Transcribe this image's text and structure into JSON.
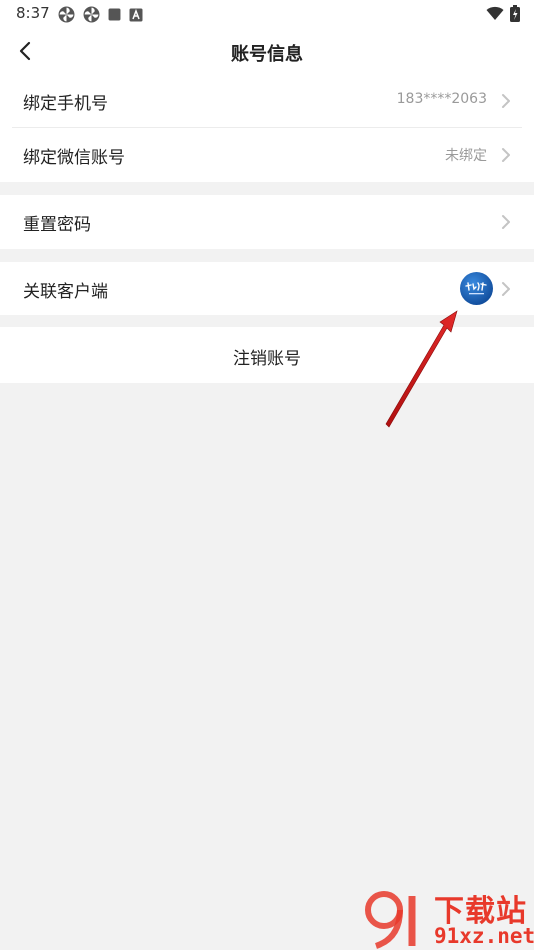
{
  "status_bar": {
    "time": "8:37",
    "icons": [
      "pinwheel-icon",
      "pinwheel-icon",
      "square-icon",
      "a-badge-icon"
    ],
    "right_icons": [
      "wifi-icon",
      "battery-icon"
    ]
  },
  "nav": {
    "title": "账号信息",
    "back_icon": "chevron-left-icon"
  },
  "rows": {
    "phone": {
      "label": "绑定手机号",
      "value": "183****2063"
    },
    "wechat": {
      "label": "绑定微信账号",
      "value": "未绑定"
    },
    "reset_password": {
      "label": "重置密码"
    },
    "linked_client": {
      "label": "关联客户端",
      "icon": "client-logo-icon"
    }
  },
  "logout": {
    "label": "注销账号"
  },
  "annotation": {
    "color": "#d81e1e",
    "icon": "red-arrow-pointer"
  },
  "watermark": {
    "title": "下载站",
    "url": "91xz.net",
    "color": "#e8392b"
  },
  "colors": {
    "background": "#f2f2f2",
    "card": "#ffffff",
    "secondary_text": "#9a9a9a"
  }
}
